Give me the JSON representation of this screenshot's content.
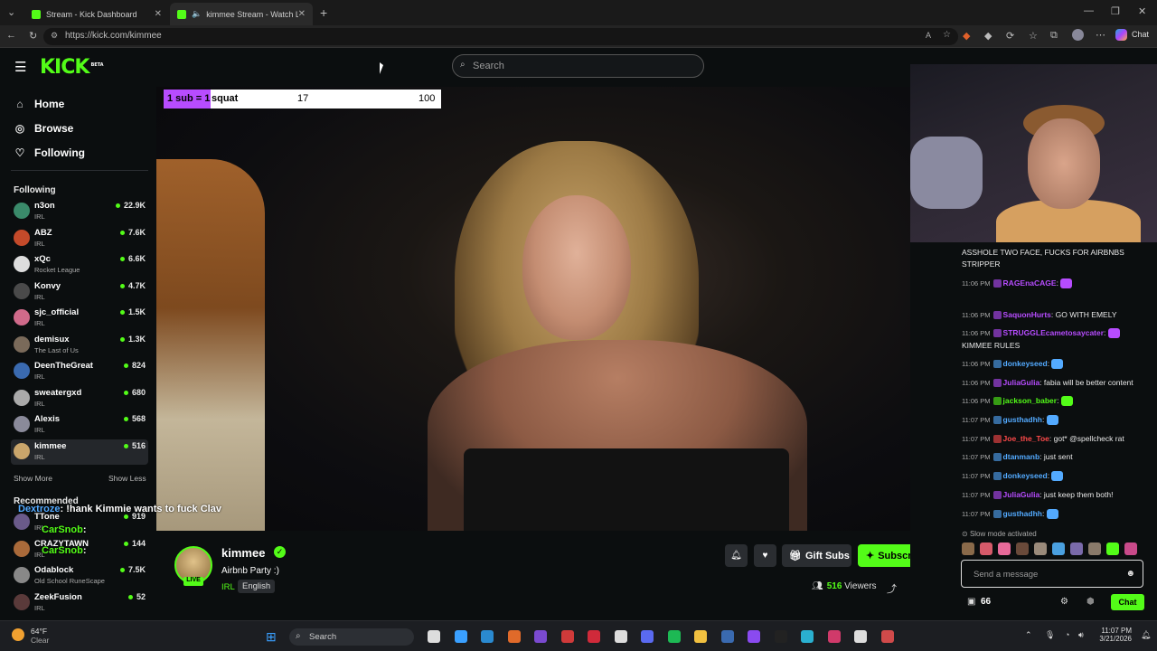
{
  "browser": {
    "tabs": [
      {
        "label": "Stream - Kick Dashboard"
      },
      {
        "label": "kimmee Stream - Watch Live"
      }
    ],
    "url": "https://kick.com/kimmee",
    "chat_button": "Chat"
  },
  "header": {
    "logo": "KICK",
    "logo_badge": "BETA",
    "search_placeholder": "Search"
  },
  "sidebar": {
    "nav": [
      {
        "label": "Home",
        "icon": "home-icon"
      },
      {
        "label": "Browse",
        "icon": "compass-icon"
      },
      {
        "label": "Following",
        "icon": "heart-icon"
      }
    ],
    "following_title": "Following",
    "following": [
      {
        "name": "n3on",
        "category": "IRL",
        "viewers": "22.9K",
        "color": "#3a8a6a"
      },
      {
        "name": "ABZ",
        "category": "IRL",
        "viewers": "7.6K",
        "color": "#c44a2a"
      },
      {
        "name": "xQc",
        "category": "Rocket League",
        "viewers": "6.6K",
        "color": "#ddd"
      },
      {
        "name": "Konvy",
        "category": "IRL",
        "viewers": "4.7K",
        "color": "#4a4a4a"
      },
      {
        "name": "sjc_official",
        "category": "IRL",
        "viewers": "1.5K",
        "color": "#d06a8a"
      },
      {
        "name": "demisux",
        "category": "The Last of Us",
        "viewers": "1.3K",
        "color": "#7a6a5a"
      },
      {
        "name": "DeenTheGreat",
        "category": "IRL",
        "viewers": "824",
        "color": "#3a6ab0"
      },
      {
        "name": "sweatergxd",
        "category": "IRL",
        "viewers": "680",
        "color": "#aaa"
      },
      {
        "name": "Alexis",
        "category": "IRL",
        "viewers": "568",
        "color": "#8a8a9a"
      },
      {
        "name": "kimmee",
        "category": "IRL",
        "viewers": "516",
        "color": "#c9a56b"
      }
    ],
    "show_more": "Show More",
    "show_less": "Show Less",
    "recommended_title": "Recommended",
    "recommended": [
      {
        "name": "TTone",
        "category": "IRL",
        "viewers": "919",
        "color": "#6a5a8a"
      },
      {
        "name": "CRAZYTAWN",
        "category": "IRL",
        "viewers": "144",
        "color": "#aa6a3a"
      },
      {
        "name": "Odablock",
        "category": "Old School RuneScape",
        "viewers": "7.5K",
        "color": "#888"
      },
      {
        "name": "ZeekFusion",
        "category": "IRL",
        "viewers": "52",
        "color": "#5a3a3a"
      }
    ],
    "overlay_chat": [
      {
        "user": "Dextroze",
        "text": ": !hank Kimmie wants to fuck Clav"
      },
      {
        "user": "CarSnob",
        "text": ":"
      },
      {
        "user": "CarSnob",
        "text": ":"
      }
    ]
  },
  "player": {
    "goal": {
      "tag": "1 sub = 1",
      "label": "squat",
      "current": "17",
      "target": "100"
    }
  },
  "stream": {
    "name": "kimmee",
    "live_badge": "LIVE",
    "title": "Airbnb Party :)",
    "category": "IRL",
    "language": "English",
    "gift_subs": "Gift Subs",
    "subscribe": "Subscribe",
    "viewers_count": "516",
    "viewers_label": "Viewers"
  },
  "chat": {
    "top_text": "ASSHOLE TWO FACE, FUCKS FOR AIRBNBS STRIPPER",
    "messages": [
      {
        "time": "11:06 PM",
        "user": "RAGEnaCAGE",
        "text": ":",
        "color": "#b74cff"
      },
      {
        "time": "11:06 PM",
        "user": "SaquonHurts",
        "text": ": GO WITH EMELY",
        "color": "#b74cff"
      },
      {
        "time": "11:06 PM",
        "user": "STRUGGLEcametosaycater",
        "text": ":",
        "color": "#b74cff"
      },
      {
        "time": "",
        "user": "",
        "text": "KIMMEE RULES",
        "color": "#fff"
      },
      {
        "time": "11:06 PM",
        "user": "donkeyseed",
        "text": ":",
        "color": "#53aaff"
      },
      {
        "time": "11:06 PM",
        "user": "JuliaGulia",
        "text": ": fabia will be better content",
        "color": "#b74cff"
      },
      {
        "time": "11:06 PM",
        "user": "jackson_baber",
        "text": ":",
        "color": "#53fc18"
      },
      {
        "time": "11:07 PM",
        "user": "gusthadhh",
        "text": ":",
        "color": "#53aaff"
      },
      {
        "time": "11:07 PM",
        "user": "Joe_the_Toe",
        "text": ": got* @spellcheck rat",
        "color": "#ff4a4a"
      },
      {
        "time": "11:07 PM",
        "user": "dtanmanb",
        "text": ": just sent",
        "color": "#53aaff"
      },
      {
        "time": "11:07 PM",
        "user": "donkeyseed",
        "text": ":",
        "color": "#53aaff"
      },
      {
        "time": "11:07 PM",
        "user": "JuliaGulia",
        "text": ": just keep them both!",
        "color": "#b74cff"
      },
      {
        "time": "11:07 PM",
        "user": "gusthadhh",
        "text": ":",
        "color": "#53aaff"
      }
    ],
    "slow_mode": "Slow mode activated",
    "input_placeholder": "Send a message",
    "kicks": "66",
    "send_label": "Chat"
  },
  "taskbar": {
    "temperature": "64°F",
    "weather": "Clear",
    "search": "Search",
    "time": "11:07 PM",
    "date": "3/21/2026"
  }
}
